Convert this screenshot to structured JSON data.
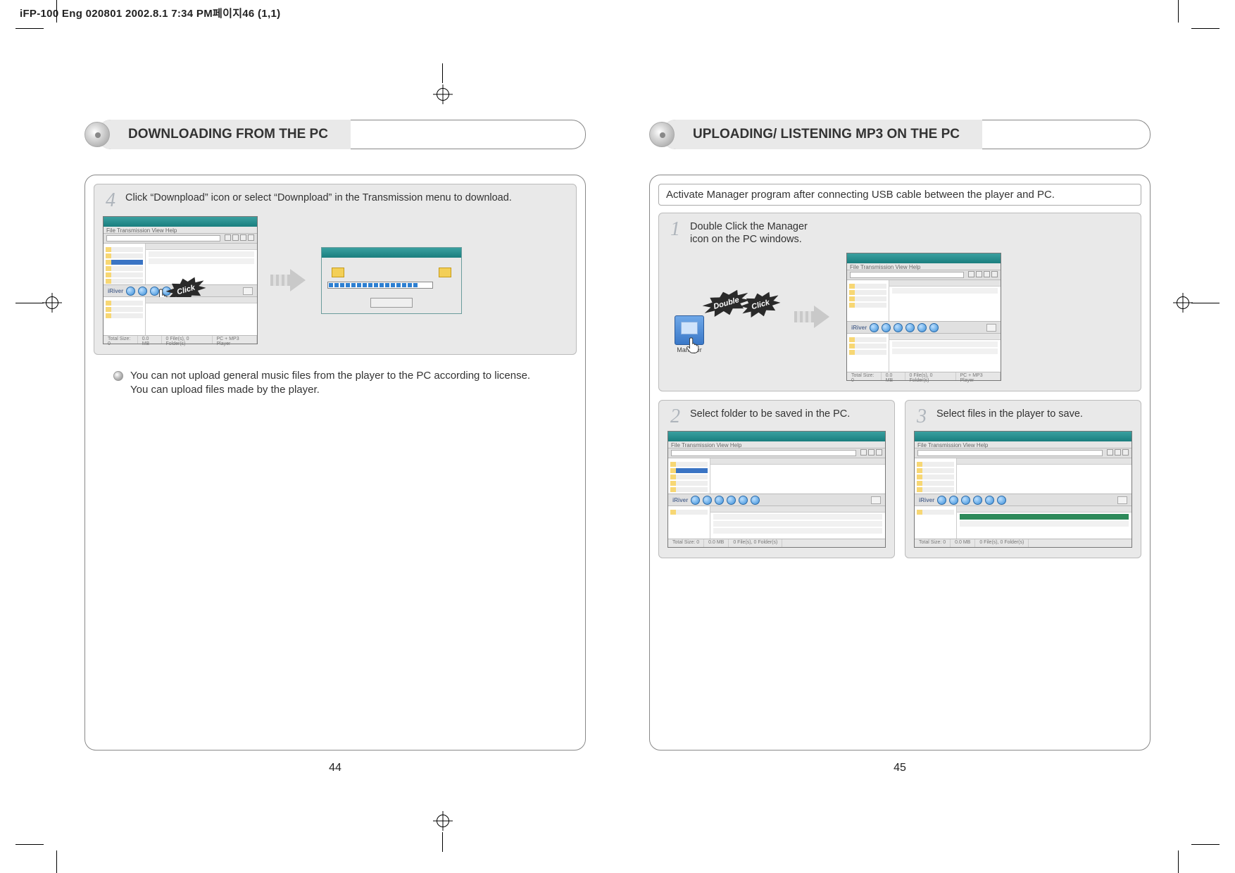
{
  "print_header": "iFP-100 Eng 020801  2002.8.1 7:34 PM페이지46 (1,1)",
  "left": {
    "title": "DOWNLOADING FROM THE PC",
    "page_num": "44",
    "step4": {
      "num": "4",
      "text": "Click “Downpload” icon or select “Downpload” in the Transmission menu to download.",
      "burst": "Click"
    },
    "note_line1": "You can not upload general music files from the player to the PC according to license.",
    "note_line2": "You can upload files made by the player."
  },
  "right": {
    "title": "UPLOADING/ LISTENING MP3 ON THE PC",
    "page_num": "45",
    "intro": "Activate Manager program after connecting USB cable between the player and PC.",
    "step1": {
      "num": "1",
      "text": "Double Click the Manager icon on the PC windows.",
      "burst1": "Double",
      "burst2": "Click",
      "icon_label": "Manager"
    },
    "step2": {
      "num": "2",
      "text": "Select folder to be saved in the PC."
    },
    "step3": {
      "num": "3",
      "text": "Select files in the player to save."
    }
  },
  "app": {
    "menu": "File  Transmission  View  Help",
    "mid_label": "iRiver",
    "status1": "Total Size: 0",
    "status2": "0.0 MB",
    "status3": "0 File(s), 0 Folder(s)",
    "status4": "PC + MP3 Player"
  }
}
